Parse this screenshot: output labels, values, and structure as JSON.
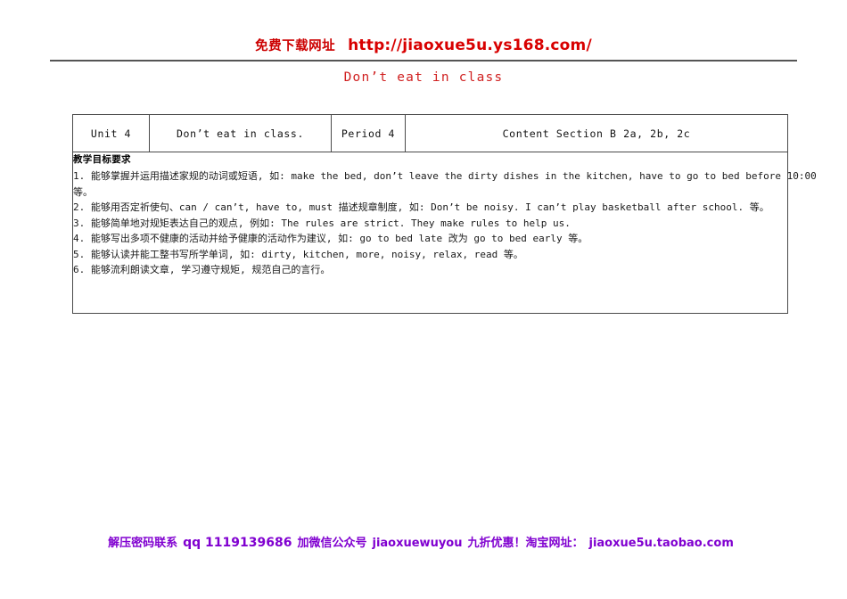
{
  "promo_header": {
    "label_cn": "免费下载网址",
    "url": "http://jiaoxue5u.ys168.com/",
    "color": "#cc0000"
  },
  "doc_title": "Don’t eat in class",
  "doc_title_color": "#d02020",
  "table": {
    "header_row": [
      {
        "key": "unit",
        "label": "Unit 4"
      },
      {
        "key": "topic",
        "label": "Don’t eat in class."
      },
      {
        "key": "period",
        "label": "Period 4"
      },
      {
        "key": "content",
        "label": "Content  Section B  2a, 2b, 2c"
      }
    ],
    "body": {
      "goals_title": "教学目标要求",
      "goals": [
        "1. 能够掌握并运用描述家规的动词或短语, 如: make the bed, don’t leave the dirty dishes in the kitchen, have to go to bed before 10:00 等。",
        "2. 能够用否定祈使句、can / can’t, have to, must 描述规章制度, 如: Don’t be noisy. I can’t play basketball after school. 等。",
        "3. 能够简单地对规矩表达自己的观点, 例如: The rules are strict. They make rules to help us.",
        "4. 能够写出多项不健康的活动并给予健康的活动作为建议, 如: go to bed late 改为 go to bed early 等。",
        "5. 能够认读并能工整书写所学单词, 如: dirty, kitchen, more, noisy, relax, read 等。",
        "6. 能够流利朗读文章, 学习遵守规矩, 规范自己的言行。"
      ],
      "goal_line_1a": "1. 能够掌握并运用描述家规的动词或短语, 如: make the bed, don’t leave the dirty dishes in the kitchen, have to go to bed before 10:00",
      "goal_line_1b": "等。",
      "goal_line_2": "2. 能够用否定祈使句、can / can’t, have to, must 描述规章制度, 如: Don’t be noisy. I can’t play basketball after school. 等。",
      "goal_line_3": "3. 能够简单地对规矩表达自己的观点, 例如: The rules are strict. They make rules to help us.",
      "goal_line_4": "4. 能够写出多项不健康的活动并给予健康的活动作为建议, 如: go to bed late 改为 go to bed early 等。",
      "goal_line_5": "5. 能够认读并能工整书写所学单词, 如: dirty, kitchen, more, noisy, relax, read 等。",
      "goal_line_6": "6. 能够流利朗读文章, 学习遵守规矩, 规范自己的言行。"
    }
  },
  "promo_footer": {
    "part1": "解压密码联系",
    "part2": "qq 1119139686",
    "part3": "加微信公众号",
    "part4": "jiaoxuewuyou",
    "part5": "九折优惠！淘宝网址：",
    "part6": "jiaoxue5u.taobao.com",
    "color": "#8000d0"
  }
}
